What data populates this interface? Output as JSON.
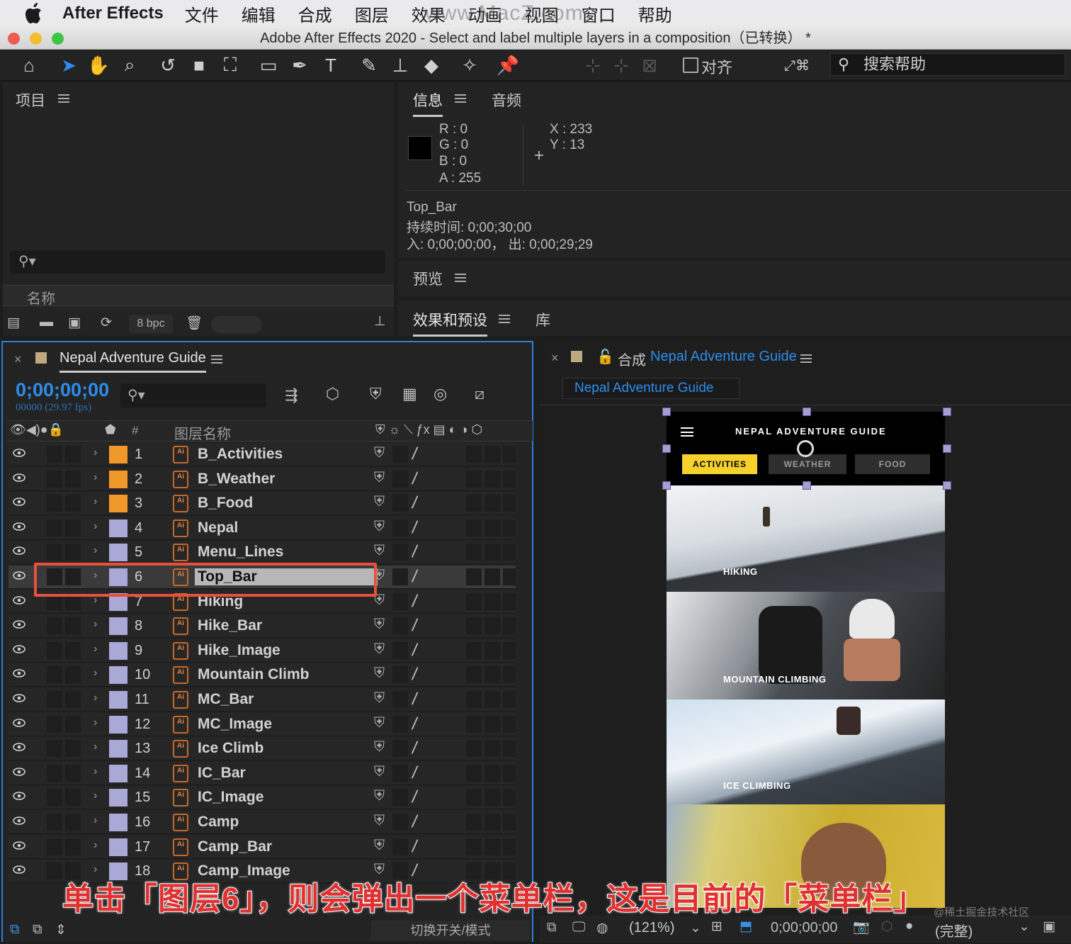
{
  "menubar": {
    "app": "After Effects",
    "items": [
      "文件",
      "编辑",
      "合成",
      "图层",
      "效果",
      "动画",
      "视图",
      "窗口",
      "帮助"
    ],
    "watermark": "www.MacZ.com"
  },
  "window": {
    "title": "Adobe After Effects 2020 - Select and label multiple layers in a composition（已转换） *"
  },
  "toolbar": {
    "snap_label": "对齐",
    "search_help": "搜索帮助"
  },
  "project": {
    "tab": "项目",
    "column_name": "名称",
    "bpc": "8 bpc"
  },
  "info": {
    "tab_info": "信息",
    "tab_audio": "音频",
    "r": "R :  0",
    "g": "G :  0",
    "b": "B :  0",
    "a": "A :  255",
    "x": "X : 233",
    "y": "Y :  13",
    "layer": "Top_Bar",
    "duration": "持续时间: 0;00;30;00",
    "inout": "入: 0;00;00;00，  出: 0;00;29;29"
  },
  "preview": {
    "tab": "预览"
  },
  "effects": {
    "tab": "效果和预设",
    "tab_lib": "库"
  },
  "timeline": {
    "comp_name": "Nepal Adventure Guide",
    "timecode": "0;00;00;00",
    "frames": "00000 (29.97 fps)",
    "col_hash": "#",
    "col_layer": "图层名称",
    "toggle_label": "切换开关/模式",
    "layers": [
      {
        "n": "1",
        "name": "B_Activities",
        "color": "#f0982a"
      },
      {
        "n": "2",
        "name": "B_Weather",
        "color": "#f0982a"
      },
      {
        "n": "3",
        "name": "B_Food",
        "color": "#f0982a"
      },
      {
        "n": "4",
        "name": "Nepal",
        "color": "#a9a8d6"
      },
      {
        "n": "5",
        "name": "Menu_Lines",
        "color": "#a9a8d6"
      },
      {
        "n": "6",
        "name": "Top_Bar",
        "color": "#a9a8d6"
      },
      {
        "n": "7",
        "name": "Hiking",
        "color": "#a9a8d6"
      },
      {
        "n": "8",
        "name": "Hike_Bar",
        "color": "#a9a8d6"
      },
      {
        "n": "9",
        "name": "Hike_Image",
        "color": "#a9a8d6"
      },
      {
        "n": "10",
        "name": "Mountain Climb",
        "color": "#a9a8d6"
      },
      {
        "n": "11",
        "name": "MC_Bar",
        "color": "#a9a8d6"
      },
      {
        "n": "12",
        "name": "MC_Image",
        "color": "#a9a8d6"
      },
      {
        "n": "13",
        "name": "Ice Climb",
        "color": "#a9a8d6"
      },
      {
        "n": "14",
        "name": "IC_Bar",
        "color": "#a9a8d6"
      },
      {
        "n": "15",
        "name": "IC_Image",
        "color": "#a9a8d6"
      },
      {
        "n": "16",
        "name": "Camp",
        "color": "#a9a8d6"
      },
      {
        "n": "17",
        "name": "Camp_Bar",
        "color": "#a9a8d6"
      },
      {
        "n": "18",
        "name": "Camp_Image",
        "color": "#a9a8d6"
      }
    ]
  },
  "composition": {
    "label": "合成",
    "name": "Nepal Adventure Guide",
    "flow_tab": "Nepal Adventure Guide",
    "zoom": "(121%)",
    "timecode": "0;00;00;00",
    "quality": "(完整)",
    "app_title": "NEPAL ADVENTURE GUIDE",
    "nav": [
      "ACTIVITIES",
      "WEATHER",
      "FOOD"
    ],
    "sections": [
      "HIKING",
      "MOUNTAIN CLIMBING",
      "ICE CLIMBING"
    ]
  },
  "caption": "单击「图层6」，则会弹出一个菜单栏，这是目前的「菜单栏」",
  "credit": "@稀土掘金技术社区"
}
